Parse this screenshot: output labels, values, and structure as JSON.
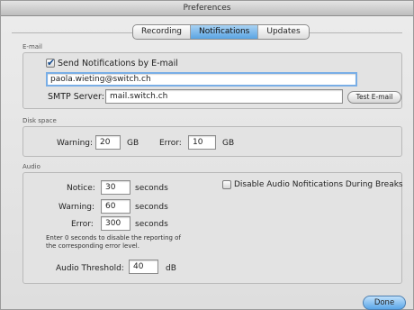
{
  "window": {
    "title": "Preferences"
  },
  "tabs": [
    {
      "label": "Recording",
      "active": false
    },
    {
      "label": "Notifications",
      "active": true
    },
    {
      "label": "Updates",
      "active": false
    }
  ],
  "email": {
    "section_label": "E-mail",
    "send_checkbox_label": "Send Notifications by E-mail",
    "send_checked": true,
    "address_value": "paola.wieting@switch.ch",
    "smtp_label": "SMTP Server:",
    "smtp_value": "mail.switch.ch",
    "test_button": "Test E-mail"
  },
  "disk": {
    "section_label": "Disk space",
    "warning_label": "Warning:",
    "warning_value": "20",
    "warning_unit": "GB",
    "error_label": "Error:",
    "error_value": "10",
    "error_unit": "GB"
  },
  "audio": {
    "section_label": "Audio",
    "notice_label": "Notice:",
    "notice_value": "30",
    "warning_label": "Warning:",
    "warning_value": "60",
    "error_label": "Error:",
    "error_value": "300",
    "seconds_unit": "seconds",
    "disable_checkbox_label": "Disable Audio Nofitications During Breaks",
    "disable_checked": false,
    "hint_line1": "Enter 0 seconds to disable the reporting of",
    "hint_line2": "the corresponding error level.",
    "threshold_label": "Audio Threshold:",
    "threshold_value": "40",
    "threshold_unit": "dB"
  },
  "footer": {
    "done_button": "Done"
  },
  "colors": {
    "accent": "#5aa4e3",
    "focus_ring": "#79aee6"
  }
}
